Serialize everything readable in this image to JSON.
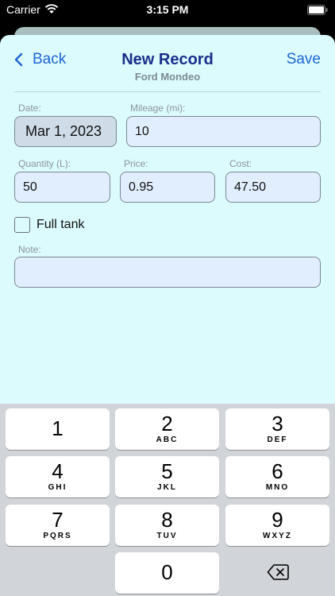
{
  "status_bar": {
    "carrier": "Carrier",
    "time": "3:15 PM"
  },
  "nav": {
    "back_label": "Back",
    "title": "New Record",
    "subtitle": "Ford Mondeo",
    "save_label": "Save"
  },
  "form": {
    "date": {
      "label": "Date:",
      "value": "Mar 1, 2023"
    },
    "mileage": {
      "label": "Mileage (mi):",
      "value": "10"
    },
    "quantity": {
      "label": "Quantity (L):",
      "value": "50"
    },
    "price": {
      "label": "Price:",
      "value": "0.95"
    },
    "cost": {
      "label": "Cost:",
      "value": "47.50"
    },
    "full_tank": {
      "label": "Full tank",
      "checked": false
    },
    "note": {
      "label": "Note:",
      "value": ""
    }
  },
  "keyboard": {
    "keys": [
      {
        "digit": "1",
        "letters": ""
      },
      {
        "digit": "2",
        "letters": "ABC"
      },
      {
        "digit": "3",
        "letters": "DEF"
      },
      {
        "digit": "4",
        "letters": "GHI"
      },
      {
        "digit": "5",
        "letters": "JKL"
      },
      {
        "digit": "6",
        "letters": "MNO"
      },
      {
        "digit": "7",
        "letters": "PQRS"
      },
      {
        "digit": "8",
        "letters": "TUV"
      },
      {
        "digit": "9",
        "letters": "WXYZ"
      },
      {
        "digit": "0",
        "letters": ""
      }
    ],
    "delete_icon": "delete-backspace-icon"
  },
  "colors": {
    "accent": "#1e66d6",
    "title": "#1a2d8a",
    "sheet_background": "#dcfbfd",
    "field_background": "#e0eefe"
  }
}
